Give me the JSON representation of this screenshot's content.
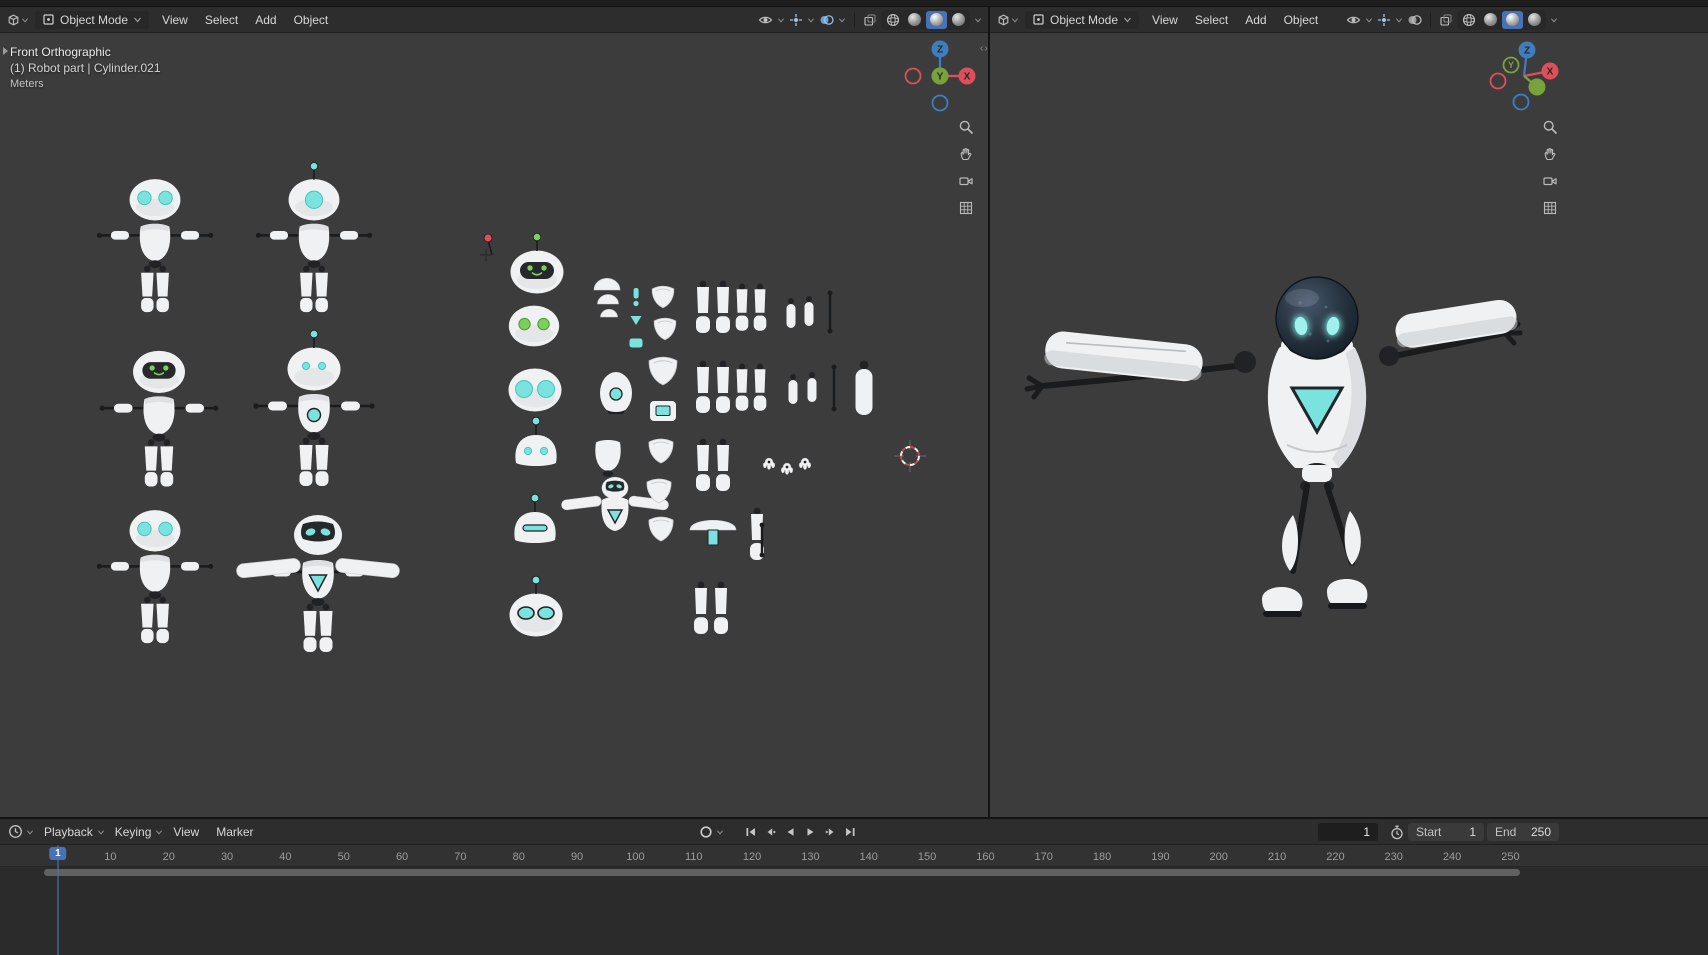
{
  "colors": {
    "accent_blue": "#4772b3",
    "robot_cyan": "#7ae3de",
    "robot_cyan_deep": "#45c4c0",
    "robot_green": "#7ccf5a",
    "axis_x_red": "#dd4f59",
    "axis_y_green": "#79a33a",
    "axis_z_blue": "#3f7dbf",
    "viewport_bg": "#3c3c3d"
  },
  "left_viewport": {
    "header": {
      "mode": "Object Mode",
      "menus": [
        "View",
        "Select",
        "Add",
        "Object"
      ]
    },
    "overlay": {
      "view_label": "Front Orthographic",
      "selection_label": "(1) Robot part | Cylinder.021",
      "units_label": "Meters"
    },
    "axis": {
      "x": "X",
      "y": "Y",
      "z": "Z"
    }
  },
  "right_viewport": {
    "header": {
      "mode": "Object Mode",
      "menus": [
        "View",
        "Select",
        "Add",
        "Object"
      ]
    },
    "axis": {
      "x": "X",
      "y": "Y",
      "z": "Z"
    }
  },
  "timeline": {
    "menus": [
      "Playback",
      "Keying",
      "View",
      "Marker"
    ],
    "current_frame_field": "1",
    "current_frame_badge": "1",
    "start": {
      "label": "Start",
      "value": "1"
    },
    "end": {
      "label": "End",
      "value": "250"
    },
    "ticks": [
      "10",
      "20",
      "30",
      "40",
      "50",
      "60",
      "70",
      "80",
      "90",
      "100",
      "110",
      "120",
      "130",
      "140",
      "150",
      "160",
      "170",
      "180",
      "190",
      "200",
      "210",
      "220",
      "230",
      "240",
      "250"
    ]
  }
}
